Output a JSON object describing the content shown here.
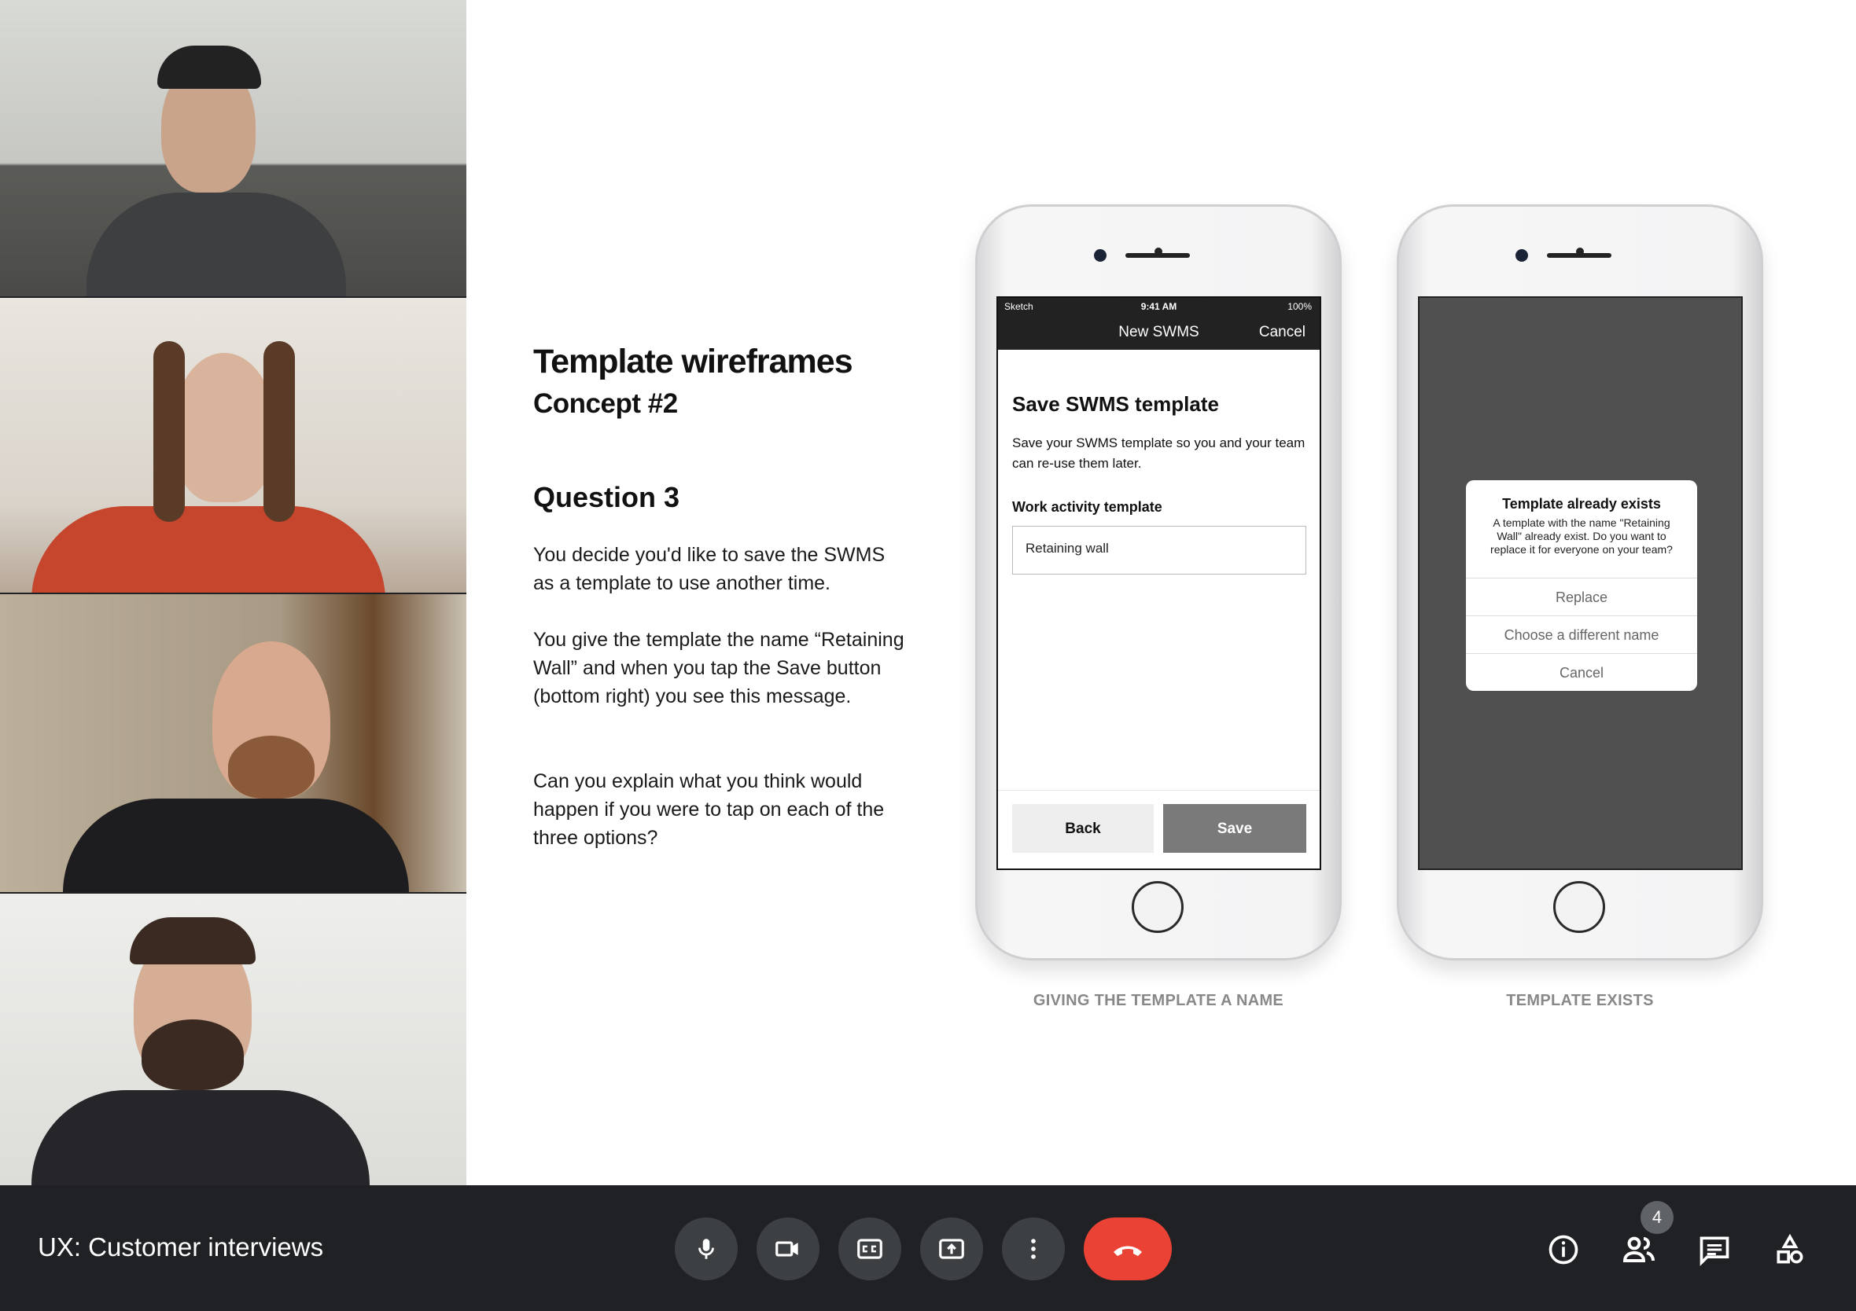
{
  "slide": {
    "title": "Template wireframes",
    "subtitle": "Concept #2",
    "question": "Question 3",
    "paragraphs": [
      "You decide you'd like to save the SWMS as a template to use another time.",
      "You give the template the name “Retaining Wall” and when you tap the Save button (bottom right) you see this message.",
      "Can you explain what you think would happen if you were to tap on each of the three options?"
    ]
  },
  "phone_a": {
    "status_left": "Sketch",
    "status_time": "9:41 AM",
    "status_right": "100%",
    "nav_title": "New SWMS",
    "nav_cancel": "Cancel",
    "heading": "Save SWMS template",
    "description": "Save your SWMS template so you and your team can re-use them later.",
    "field_label": "Work activity template",
    "field_value": "Retaining wall",
    "back_label": "Back",
    "save_label": "Save",
    "caption": "GIVING THE TEMPLATE A NAME"
  },
  "phone_b": {
    "dialog_title": "Template already exists",
    "dialog_body": "A template with the name \"Retaining Wall\" already exist. Do you want to replace it for everyone on your team?",
    "options": [
      "Replace",
      "Choose a different name",
      "Cancel"
    ],
    "caption": "TEMPLATE EXISTS"
  },
  "meet": {
    "meeting_title": "UX: Customer interviews",
    "participant_count": "4",
    "controls": [
      "mic-icon",
      "camera-icon",
      "captions-icon",
      "present-icon",
      "more-options-icon",
      "end-call-icon"
    ],
    "right_icons": [
      "info-icon",
      "people-icon",
      "chat-icon",
      "activities-icon"
    ],
    "accent_end_call": "#ea4335",
    "bar_color": "#202124"
  }
}
